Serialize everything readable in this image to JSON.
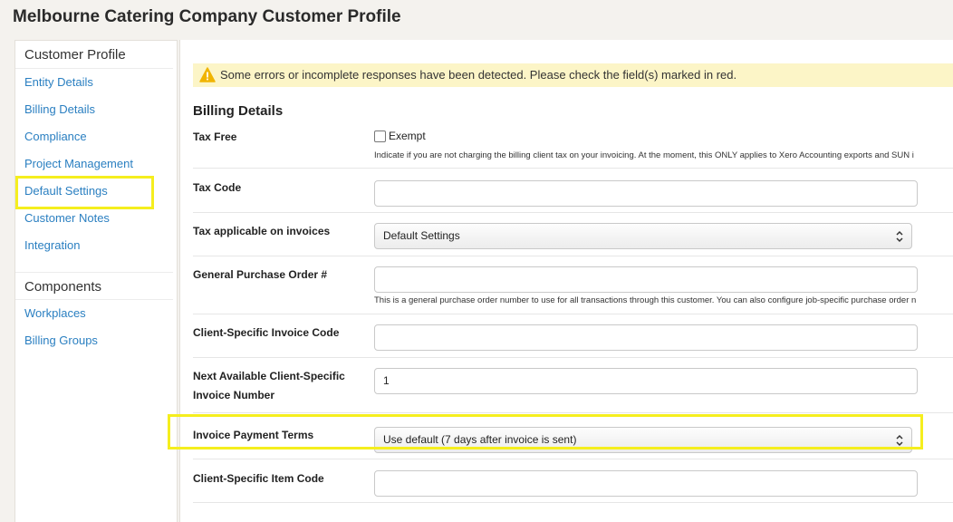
{
  "page": {
    "title": "Melbourne Catering Company Customer Profile"
  },
  "sidebar": {
    "section1": "Customer Profile",
    "items1": [
      {
        "label": "Entity Details"
      },
      {
        "label": "Billing Details"
      },
      {
        "label": "Compliance"
      },
      {
        "label": "Project Management"
      },
      {
        "label": "Default Settings"
      },
      {
        "label": "Customer Notes"
      },
      {
        "label": "Integration"
      }
    ],
    "section2": "Components",
    "items2": [
      {
        "label": "Workplaces"
      },
      {
        "label": "Billing Groups"
      }
    ]
  },
  "alert": {
    "message": "Some errors or incomplete responses have been detected. Please check the field(s) marked in red."
  },
  "form": {
    "title": "Billing Details",
    "tax_free": {
      "label": "Tax Free",
      "checkbox_label": "Exempt",
      "checked": false,
      "help": "Indicate if you are not charging the billing client tax on your invoicing. At the moment, this ONLY applies to Xero Accounting exports and SUN i"
    },
    "tax_code": {
      "label": "Tax Code",
      "value": ""
    },
    "tax_applicable": {
      "label": "Tax applicable on invoices",
      "selected": "Default Settings"
    },
    "purchase_order": {
      "label": "General Purchase Order #",
      "value": "",
      "help": "This is a general purchase order number to use for all transactions through this customer. You can also configure job-specific purchase order n"
    },
    "invoice_code": {
      "label": "Client-Specific Invoice Code",
      "value": ""
    },
    "next_invoice": {
      "label": "Next Available Client-Specific Invoice Number",
      "value": "1"
    },
    "payment_terms": {
      "label": "Invoice Payment Terms",
      "selected": "Use default (7 days after invoice is sent)"
    },
    "item_code": {
      "label": "Client-Specific Item Code",
      "value": ""
    }
  },
  "colors": {
    "link": "#2a7fc1",
    "highlight": "#f5ee1e",
    "alert_bg": "#fcf5c7",
    "warning": "#f0b400"
  }
}
